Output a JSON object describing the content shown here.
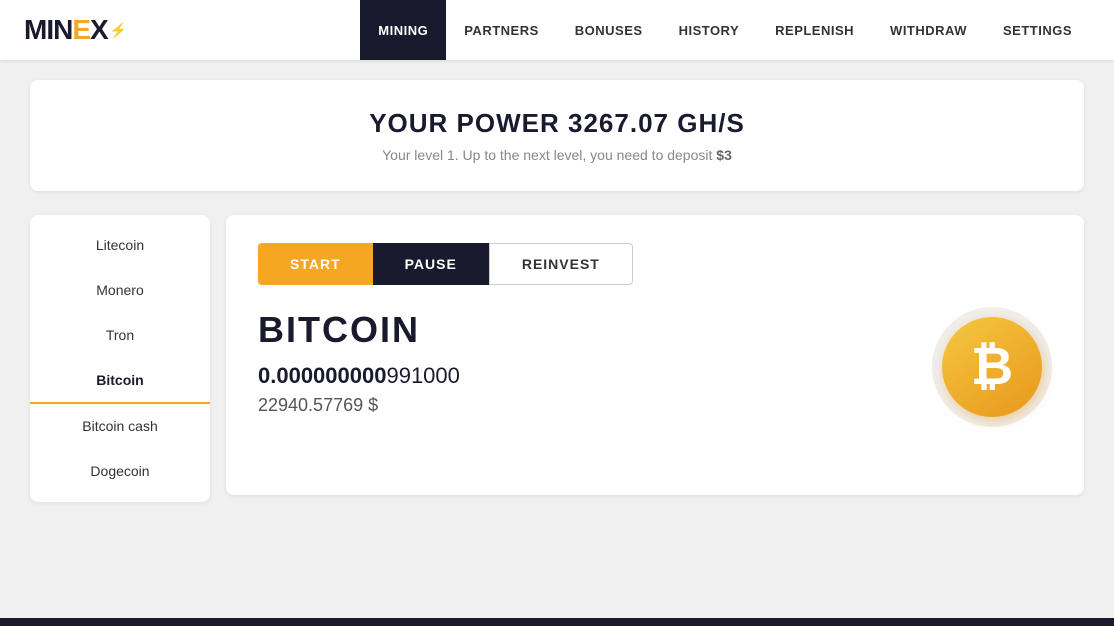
{
  "brand": {
    "name_part1": "MIN",
    "name_e": "E",
    "name_x": "X",
    "icon_symbol": "⚡"
  },
  "nav": {
    "items": [
      {
        "label": "MINING",
        "active": true
      },
      {
        "label": "PARTNERS",
        "active": false
      },
      {
        "label": "BONUSES",
        "active": false
      },
      {
        "label": "HISTORY",
        "active": false
      },
      {
        "label": "REPLENISH",
        "active": false
      },
      {
        "label": "WITHDRAW",
        "active": false
      },
      {
        "label": "SETTINGS",
        "active": false
      }
    ]
  },
  "power": {
    "title": "YOUR POWER 3267.07 GH/S",
    "subtitle_prefix": "Your level 1. Up to the next level, you need to deposit ",
    "subtitle_amount": "$3"
  },
  "sidebar": {
    "items": [
      {
        "label": "Litecoin",
        "active": false
      },
      {
        "label": "Monero",
        "active": false
      },
      {
        "label": "Tron",
        "active": false
      },
      {
        "label": "Bitcoin",
        "active": true
      },
      {
        "label": "Bitcoin cash",
        "active": false
      },
      {
        "label": "Dogecoin",
        "active": false
      }
    ]
  },
  "mining": {
    "buttons": {
      "start": "START",
      "pause": "PAUSE",
      "reinvest": "REINVEST"
    },
    "coin_name": "BITCOIN",
    "balance_bold": "0.000000000",
    "balance_light": "991000",
    "balance_usd": "22940.57769 $",
    "coin_symbol": "₿"
  }
}
